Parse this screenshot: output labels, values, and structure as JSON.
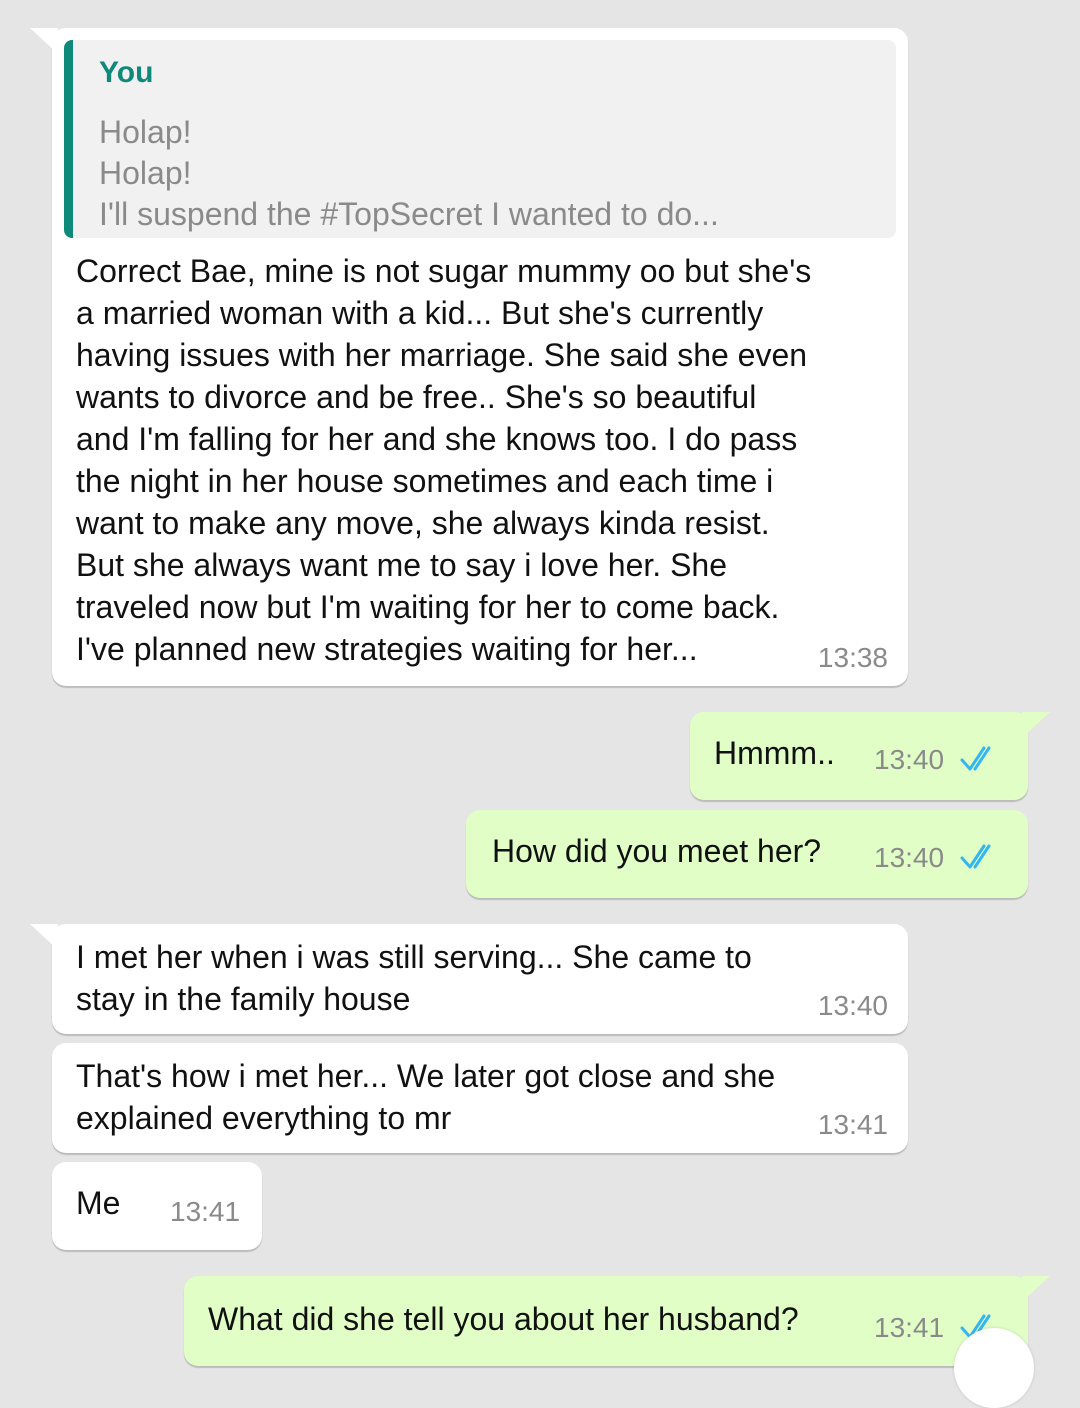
{
  "conversation": {
    "messages": [
      {
        "direction": "incoming",
        "quote": {
          "author": "You",
          "lines": [
            "Holap!",
            "Holap!",
            "I'll suspend the #TopSecret I wanted to do..."
          ]
        },
        "lines": [
          "Correct Bae, mine is not sugar mummy oo but she's",
          "a married woman with a kid... But she's currently",
          "having issues with her marriage. She said she even",
          "wants to divorce and be free.. She's so beautiful",
          "and I'm falling for her and she knows too. I do pass",
          "the night in her house sometimes and each time i",
          "want to make any move, she always kinda resist.",
          "But she always want me to say i love her. She",
          "traveled now but I'm waiting for her to come back.",
          "I've planned new strategies waiting for her..."
        ],
        "time": "13:38"
      },
      {
        "direction": "outgoing",
        "lines": [
          "Hmmm.."
        ],
        "time": "13:40",
        "status": "read"
      },
      {
        "direction": "outgoing",
        "lines": [
          "How did you meet her?"
        ],
        "time": "13:40",
        "status": "read"
      },
      {
        "direction": "incoming",
        "lines": [
          "I met her when i was still serving... She came to",
          "stay in the family house"
        ],
        "time": "13:40"
      },
      {
        "direction": "incoming",
        "lines": [
          "That's how i met her... We later got close and she",
          "explained everything to mr"
        ],
        "time": "13:41"
      },
      {
        "direction": "incoming",
        "lines": [
          "Me"
        ],
        "time": "13:41"
      },
      {
        "direction": "outgoing",
        "lines": [
          "What did she tell you about her husband?"
        ],
        "time": "13:41",
        "status": "read"
      }
    ]
  },
  "colors": {
    "background": "#e5e5e5",
    "incoming_bubble": "#ffffff",
    "outgoing_bubble": "#e1fec6",
    "quote_accent": "#0f8a7a",
    "read_ticks": "#34b7f1",
    "timestamp": "#8a8a8a"
  },
  "icons": {
    "read_receipt": "double-check-icon"
  }
}
